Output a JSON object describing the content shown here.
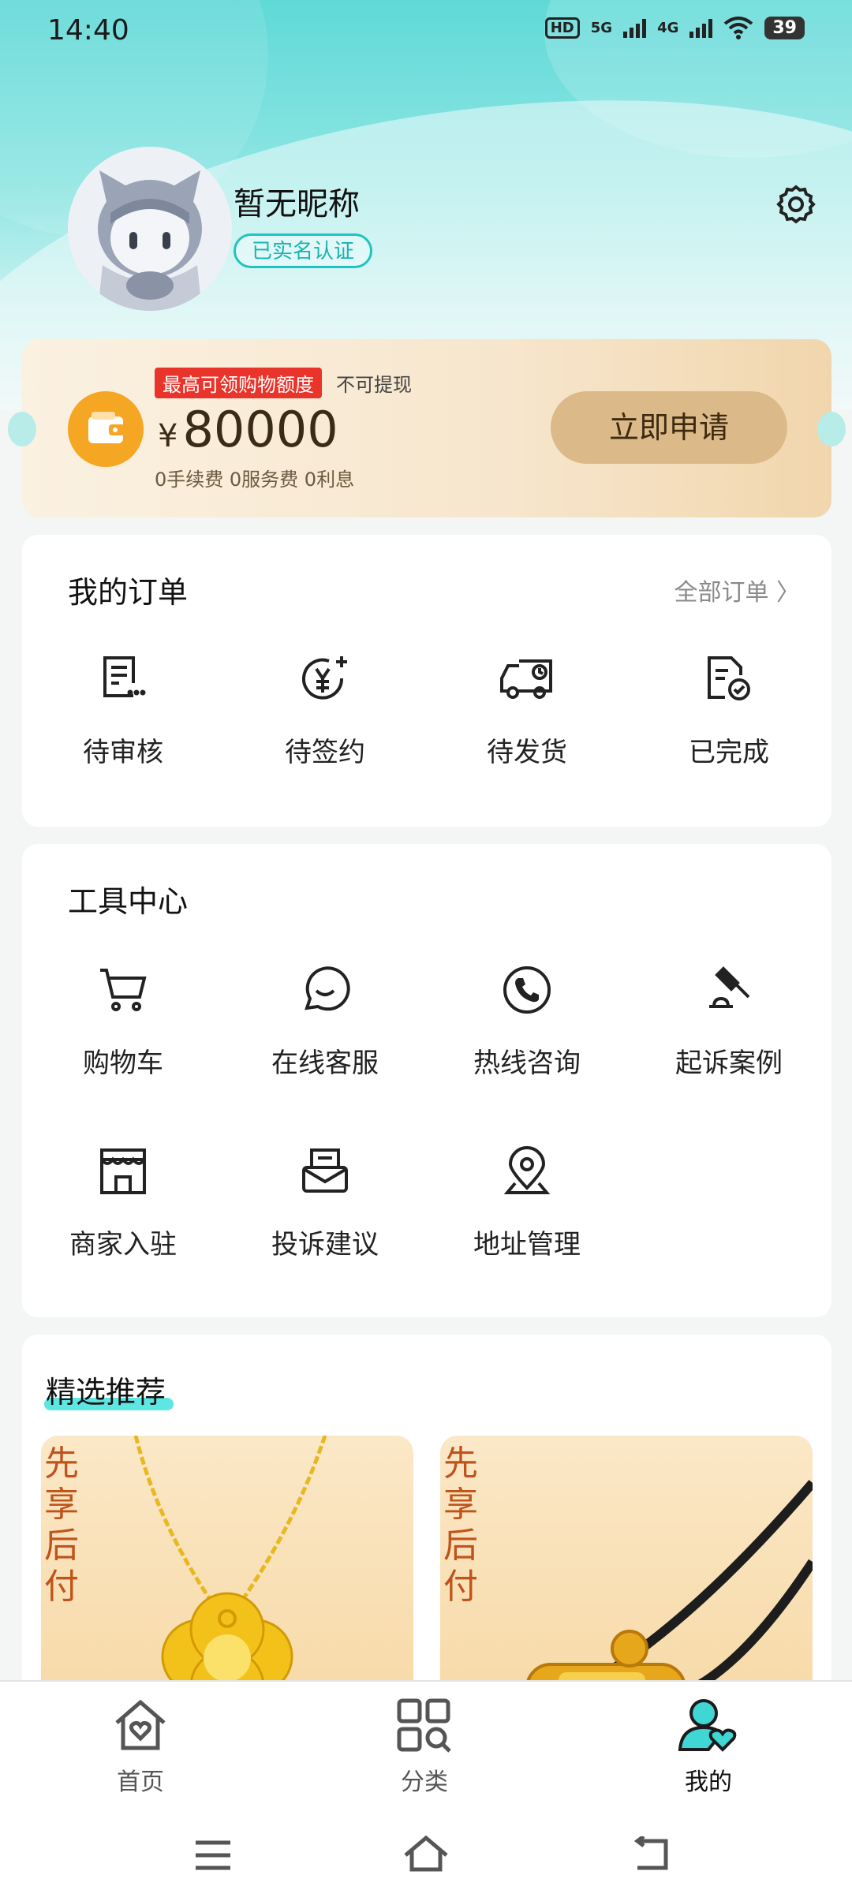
{
  "status_bar": {
    "time": "14:40",
    "hd": "HD",
    "net1": "5G",
    "net2": "4G",
    "battery": "39"
  },
  "profile": {
    "nickname": "暂无昵称",
    "verify_badge": "已实名认证"
  },
  "credit": {
    "tag": "最高可领购物额度",
    "tag_note": "不可提现",
    "currency": "¥",
    "amount": "80000",
    "fees": "0手续费 0服务费 0利息",
    "apply_label": "立即申请"
  },
  "orders": {
    "title": "我的订单",
    "all_label": "全部订单 〉",
    "items": [
      {
        "label": "待审核",
        "icon": "document-list-icon"
      },
      {
        "label": "待签约",
        "icon": "yen-coin-icon"
      },
      {
        "label": "待发货",
        "icon": "delivery-truck-icon"
      },
      {
        "label": "已完成",
        "icon": "document-check-icon"
      }
    ]
  },
  "tools": {
    "title": "工具中心",
    "items": [
      {
        "label": "购物车",
        "icon": "cart-icon"
      },
      {
        "label": "在线客服",
        "icon": "chat-icon"
      },
      {
        "label": "热线咨询",
        "icon": "phone-icon"
      },
      {
        "label": "起诉案例",
        "icon": "gavel-icon"
      },
      {
        "label": "商家入驻",
        "icon": "store-icon"
      },
      {
        "label": "投诉建议",
        "icon": "mail-icon"
      },
      {
        "label": "地址管理",
        "icon": "location-pin-icon"
      }
    ]
  },
  "recommend": {
    "title": "精选推荐",
    "products": [
      {
        "stamp": "先享后付",
        "name": "gold-necklace"
      },
      {
        "stamp": "先享后付",
        "name": "gold-pendant-cord"
      }
    ]
  },
  "tabbar": {
    "items": [
      {
        "label": "首页",
        "icon": "home-heart-icon"
      },
      {
        "label": "分类",
        "icon": "category-grid-icon"
      },
      {
        "label": "我的",
        "icon": "user-heart-icon",
        "active": true
      }
    ]
  },
  "colors": {
    "accent": "#1fc4c0",
    "tag_red": "#e8342a",
    "apply_bg": "#dcb989",
    "wallet": "#f5a623"
  }
}
